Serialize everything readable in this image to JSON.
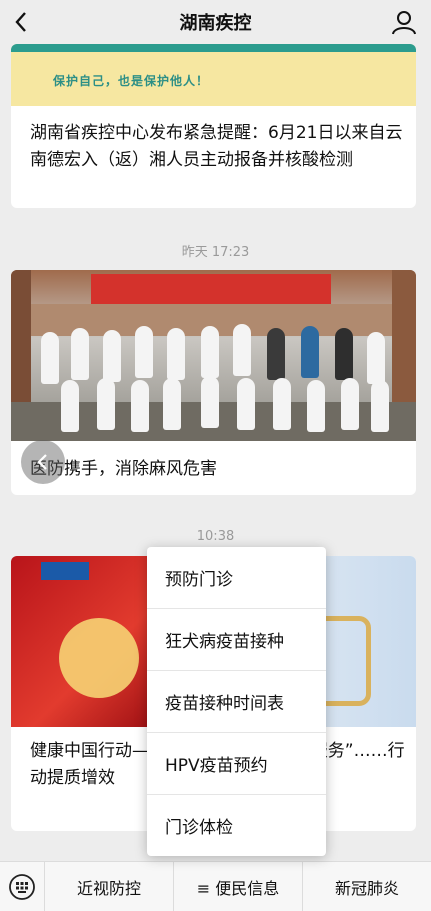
{
  "header": {
    "title": "湖南疾控"
  },
  "feed": [
    {
      "banner_slogan": "保护自己，也是保护他人！",
      "headline": "湖南省疾控中心发布紧急提醒：6月21日以来自云南德宏入（返）湘人员主动报备并核酸检测"
    },
    {
      "time": "昨天 17:23",
      "headline": "医防携手，消除麻风危害"
    },
    {
      "time": "10:38",
      "headline": "健康中国行动—“……有高质量的健康服务”……行动提质增效"
    }
  ],
  "popup_menu": {
    "items": [
      "预防门诊",
      "狂犬病疫苗接种",
      "疫苗接种时间表",
      "HPV疫苗预约",
      "门诊体检"
    ]
  },
  "bottom_bar": {
    "tabs": [
      "近视防控",
      "≡ 便民信息",
      "新冠肺炎"
    ]
  },
  "colors": {
    "accent_teal": "#2c9c8e",
    "banner_yellow": "#f6e7a1",
    "background": "#ededed"
  }
}
